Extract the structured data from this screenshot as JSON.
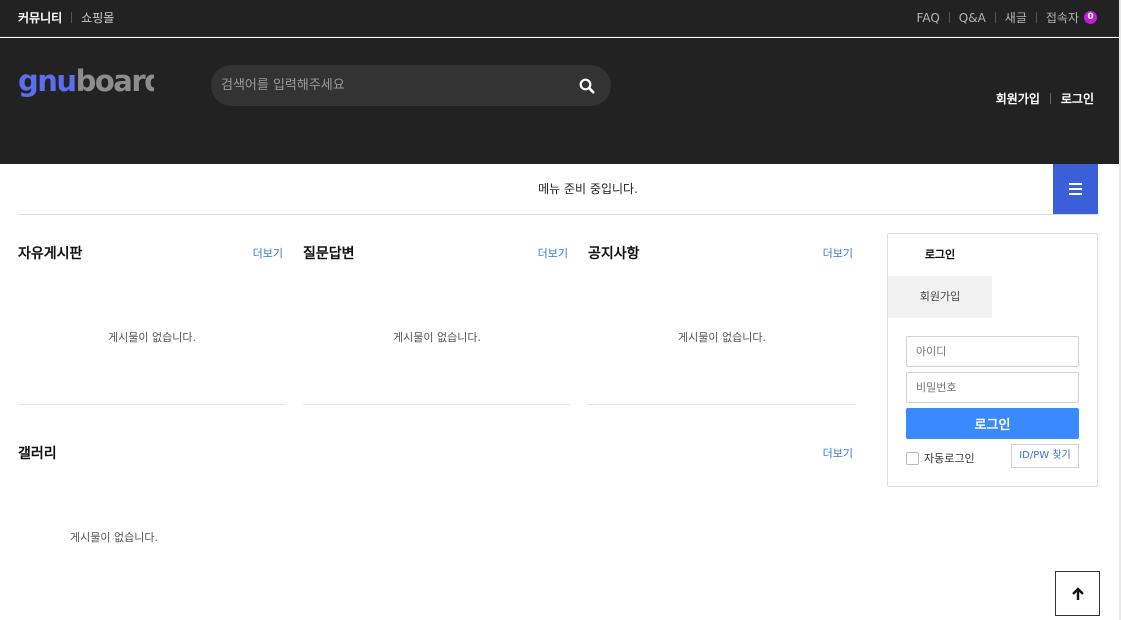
{
  "topbar": {
    "left": [
      {
        "label": "커뮤니티",
        "active": true
      },
      {
        "label": "쇼핑몰",
        "active": false
      }
    ],
    "right": {
      "faq": "FAQ",
      "qa": "Q&A",
      "new": "새글",
      "visitors": "접속자",
      "visitors_count": "0"
    }
  },
  "header": {
    "logo_text": "gnuboard",
    "search_placeholder": "검색어를 입력해주세요",
    "join": "회원가입",
    "login": "로그인"
  },
  "menu": {
    "notice": "메뉴 준비 중입니다."
  },
  "boards": [
    {
      "title": "자유게시판",
      "more": "더보기",
      "empty": "게시물이 없습니다."
    },
    {
      "title": "질문답변",
      "more": "더보기",
      "empty": "게시물이 없습니다."
    },
    {
      "title": "공지사항",
      "more": "더보기",
      "empty": "게시물이 없습니다."
    }
  ],
  "gallery": {
    "title": "갤러리",
    "more": "더보기",
    "empty": "게시물이 없습니다."
  },
  "loginbox": {
    "tab_login": "로그인",
    "tab_join": "회원가입",
    "id_placeholder": "아이디",
    "pw_placeholder": "비밀번호",
    "submit": "로그인",
    "auto_login": "자동로그인",
    "find": "ID/PW 찾기"
  },
  "colors": {
    "accent": "#3a8afd",
    "menu_toggle": "#3a5fd8",
    "badge": "#c71ad6",
    "header_bg": "#222222",
    "logo_blue": "#5b6ef0"
  }
}
